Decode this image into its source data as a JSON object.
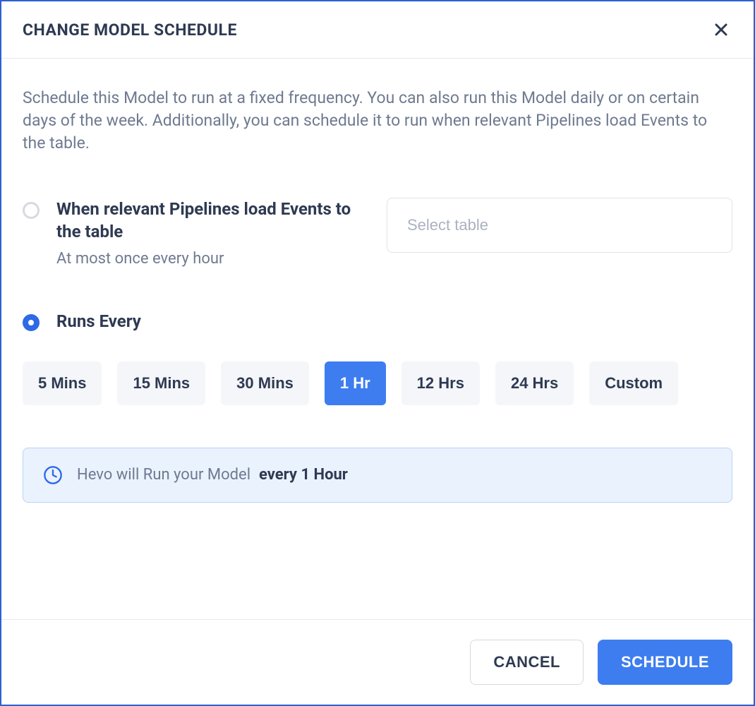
{
  "header": {
    "title": "CHANGE MODEL SCHEDULE"
  },
  "description": "Schedule this Model to run at a fixed frequency. You can also run this Model daily or on certain days of the week. Additionally, you can schedule it to run when relevant Pipelines load Events to the table.",
  "options": {
    "pipeline": {
      "title": "When relevant Pipelines load Events to the table",
      "subtitle": "At most once every hour",
      "selected": false,
      "table_placeholder": "Select table"
    },
    "runs_every": {
      "title": "Runs Every",
      "selected": true
    }
  },
  "frequencies": [
    {
      "label": "5 Mins",
      "selected": false
    },
    {
      "label": "15 Mins",
      "selected": false
    },
    {
      "label": "30 Mins",
      "selected": false
    },
    {
      "label": "1 Hr",
      "selected": true
    },
    {
      "label": "12 Hrs",
      "selected": false
    },
    {
      "label": "24 Hrs",
      "selected": false
    },
    {
      "label": "Custom",
      "selected": false
    }
  ],
  "info": {
    "prefix": "Hevo will Run your Model",
    "highlight": "every 1 Hour"
  },
  "footer": {
    "cancel": "CANCEL",
    "schedule": "SCHEDULE"
  }
}
